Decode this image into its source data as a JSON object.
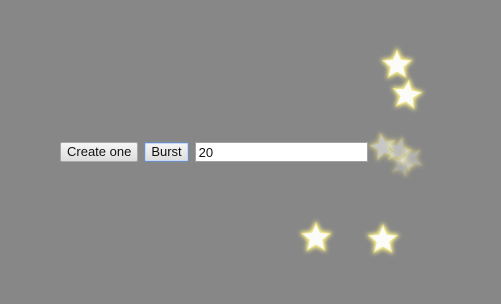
{
  "controls": {
    "create_one_label": "Create one",
    "burst_label": "Burst",
    "count_value": "20"
  },
  "stars": [
    {
      "icon": "star-icon",
      "opacity": 1.0,
      "rotation": 0
    },
    {
      "icon": "star-icon",
      "opacity": 1.0,
      "rotation": 8
    },
    {
      "icon": "star-icon",
      "opacity": 0.55,
      "rotation": -12
    },
    {
      "icon": "star-icon",
      "opacity": 0.45,
      "rotation": 15
    },
    {
      "icon": "star-icon",
      "opacity": 0.35,
      "rotation": -25
    },
    {
      "icon": "star-icon",
      "opacity": 0.3,
      "rotation": 20
    },
    {
      "icon": "star-icon",
      "opacity": 1.0,
      "rotation": 0
    },
    {
      "icon": "star-icon",
      "opacity": 1.0,
      "rotation": 0
    }
  ]
}
